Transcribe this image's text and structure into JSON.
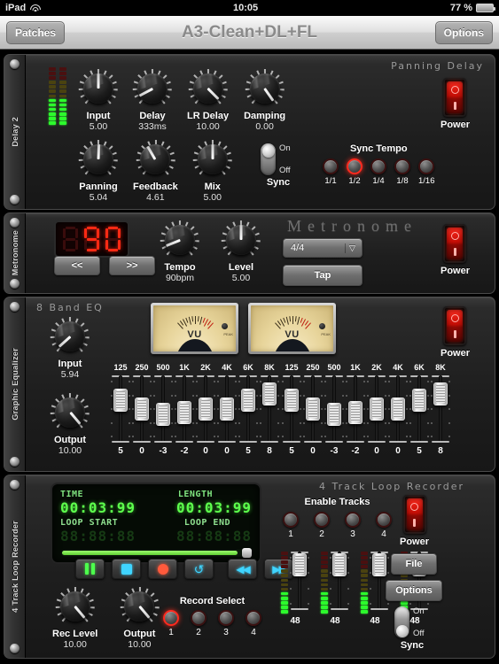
{
  "status_bar": {
    "device": "iPad",
    "wifi_icon": "wifi-icon",
    "time": "10:05",
    "battery_percent": "77 %",
    "battery_icon": "battery-icon"
  },
  "nav_bar": {
    "left_button": "Patches",
    "title": "A3-Clean+DL+FL",
    "right_button": "Options"
  },
  "units": {
    "delay": {
      "rail_label": "Delay 2",
      "panel_title": "Panning Delay",
      "knobs_row1": [
        {
          "label": "Input",
          "value": "5.00",
          "angle": 0
        },
        {
          "label": "Delay",
          "value": "333ms",
          "angle": -118
        },
        {
          "label": "LR Delay",
          "value": "10.00",
          "angle": 135
        },
        {
          "label": "Damping",
          "value": "0.00",
          "angle": 145
        }
      ],
      "knobs_row2": [
        {
          "label": "Panning",
          "value": "5.04",
          "angle": 2
        },
        {
          "label": "Feedback",
          "value": "4.61",
          "angle": -30
        },
        {
          "label": "Mix",
          "value": "5.00",
          "angle": 0
        }
      ],
      "sync_label": "Sync",
      "sync_on_label": "On",
      "sync_off_label": "Off",
      "sync_state": "on",
      "sync_tempo_label": "Sync Tempo",
      "sync_tempo_options": [
        "1/1",
        "1/2",
        "1/4",
        "1/8",
        "1/16"
      ],
      "sync_tempo_active": "1/2",
      "power_label": "Power",
      "power_on": true,
      "meter_left": {
        "green": 6,
        "dim_yellow": 4,
        "dim_red": 3
      },
      "meter_right": {
        "green": 6,
        "dim_yellow": 4,
        "dim_red": 3
      }
    },
    "metronome": {
      "rail_label": "Metronome",
      "panel_title": "Metronome",
      "bpm_digits": [
        "dim8",
        "9",
        "0"
      ],
      "prev_button": "<<",
      "next_button": ">>",
      "knobs": [
        {
          "label": "Tempo",
          "value": "90bpm",
          "angle": -112
        },
        {
          "label": "Level",
          "value": "5.00",
          "angle": 0
        }
      ],
      "time_signature": "4/4",
      "time_signature_arrow": "chevron-down-icon",
      "tap_button": "Tap",
      "power_label": "Power",
      "power_on": true
    },
    "equalizer": {
      "rail_label": "Graphic Equalizer",
      "panel_title": "8 Band EQ",
      "input_knob": {
        "label": "Input",
        "value": "5.94",
        "angle": -132
      },
      "output_knob": {
        "label": "Output",
        "value": "10.00",
        "angle": 140
      },
      "vu_label": "VU",
      "vu_peak_label": "PEAK",
      "vu_needle_angle": -28,
      "power_label": "Power",
      "power_on": true,
      "bands": [
        "125",
        "250",
        "500",
        "1K",
        "2K",
        "4K",
        "6K",
        "8K"
      ],
      "left_values": [
        "5",
        "0",
        "-3",
        "-2",
        "0",
        "0",
        "5",
        "8"
      ],
      "right_values": [
        "5",
        "0",
        "-3",
        "-2",
        "0",
        "0",
        "5",
        "8"
      ]
    },
    "looper": {
      "rail_label": "4 Track Loop Recorder",
      "panel_title": "4 Track Loop Recorder",
      "lcd": {
        "time_label": "TIME",
        "time_value": "00:03:99",
        "length_label": "LENGTH",
        "length_value": "00:03:99",
        "loop_start_label": "LOOP START",
        "loop_start_value": "88:88:88",
        "loop_end_label": "LOOP END",
        "loop_end_value": "88:88:88"
      },
      "transport": [
        {
          "name": "pause-button",
          "icon": "pause-icon"
        },
        {
          "name": "stop-button",
          "icon": "stop-icon"
        },
        {
          "name": "record-button",
          "icon": "record-icon"
        },
        {
          "name": "loop-button",
          "icon": "loop-icon"
        },
        {
          "name": "rewind-button",
          "icon": "rewind-icon"
        },
        {
          "name": "forward-button",
          "icon": "forward-icon"
        }
      ],
      "enable_tracks_label": "Enable Tracks",
      "enable_tracks": [
        "1",
        "2",
        "3",
        "4"
      ],
      "enable_tracks_active": [],
      "power_label": "Power",
      "power_on": true,
      "file_button": "File",
      "options_button": "Options",
      "knobs": [
        {
          "label": "Rec Level",
          "value": "10.00",
          "angle": 140
        },
        {
          "label": "Output",
          "value": "10.00",
          "angle": 140
        }
      ],
      "record_select_label": "Record Select",
      "record_select": [
        "1",
        "2",
        "3",
        "4"
      ],
      "record_select_active": "1",
      "track_values": [
        "48",
        "48",
        "48",
        "48"
      ],
      "sync_label": "Sync",
      "sync_on_label": "On",
      "sync_off_label": "Off",
      "sync_state": "off"
    }
  }
}
